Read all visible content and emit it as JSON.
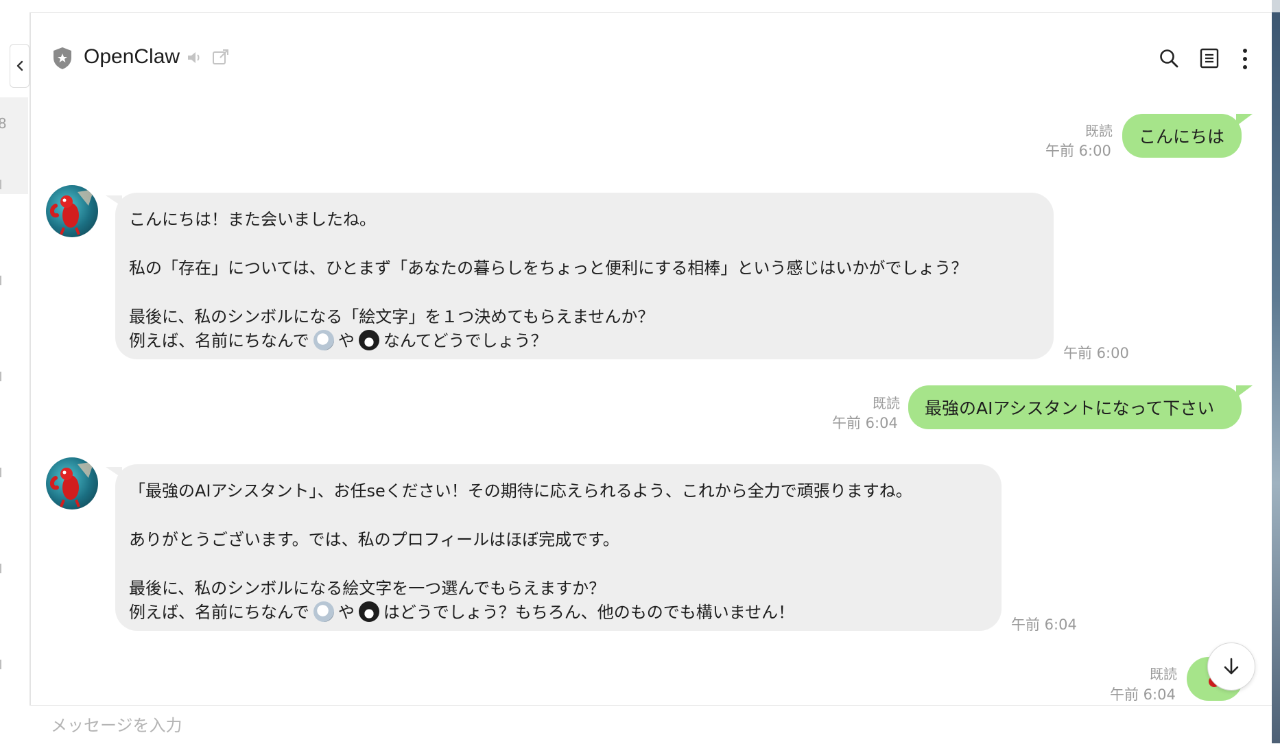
{
  "header": {
    "title": "OpenClaw",
    "icons": [
      "shield-star-icon",
      "speaker-muted-icon",
      "external-link-icon",
      "search-icon",
      "notes-icon",
      "more-vertical-icon"
    ]
  },
  "sidebar": {
    "collapse_icon": "chevron-left-icon",
    "partial_digit": "8"
  },
  "messages": [
    {
      "side": "out",
      "read": "既読",
      "time": "午前 6:00",
      "text": "こんにちは"
    },
    {
      "side": "in",
      "time": "午前 6:00",
      "lines": [
        "こんにちは！また会いましたね。",
        "私の「存在」については、ひとまず「あなたの暮らしをちょっと便利にする相棒」という感じはいかがでしょう？",
        "最後に、私のシンボルになる「絵文字」を１つ決めてもらえませんか？",
        "例えば、名前にちなんで",
        "や",
        "なんてどうでしょう？"
      ]
    },
    {
      "side": "out",
      "read": "既読",
      "time": "午前 6:04",
      "text": "最強のAIアシスタントになって下さい"
    },
    {
      "side": "in",
      "time": "午前 6:04",
      "lines": [
        "「最強のAIアシスタント」、お任seください！その期待に応えられるよう、これから全力で頑張りますね。",
        "ありがとうございます。では、私のプロフィールはほぼ完成です。",
        "最後に、私のシンボルになる絵文字を一つ選んでもらえますか？",
        "例えば、名前にちなんで",
        "や",
        "はどうでしょう？もちろん、他のものでも構いません！"
      ]
    },
    {
      "side": "out",
      "read": "既読",
      "time": "午前 6:04",
      "kind": "sticker"
    }
  ],
  "composer": {
    "placeholder": "メッセージを入力"
  },
  "scroll_button": {
    "icon": "arrow-down-icon"
  },
  "colors": {
    "outgoing_bubble": "#a6e48a",
    "incoming_bubble": "#eeeeee",
    "meta_text": "#9a9a9a"
  }
}
